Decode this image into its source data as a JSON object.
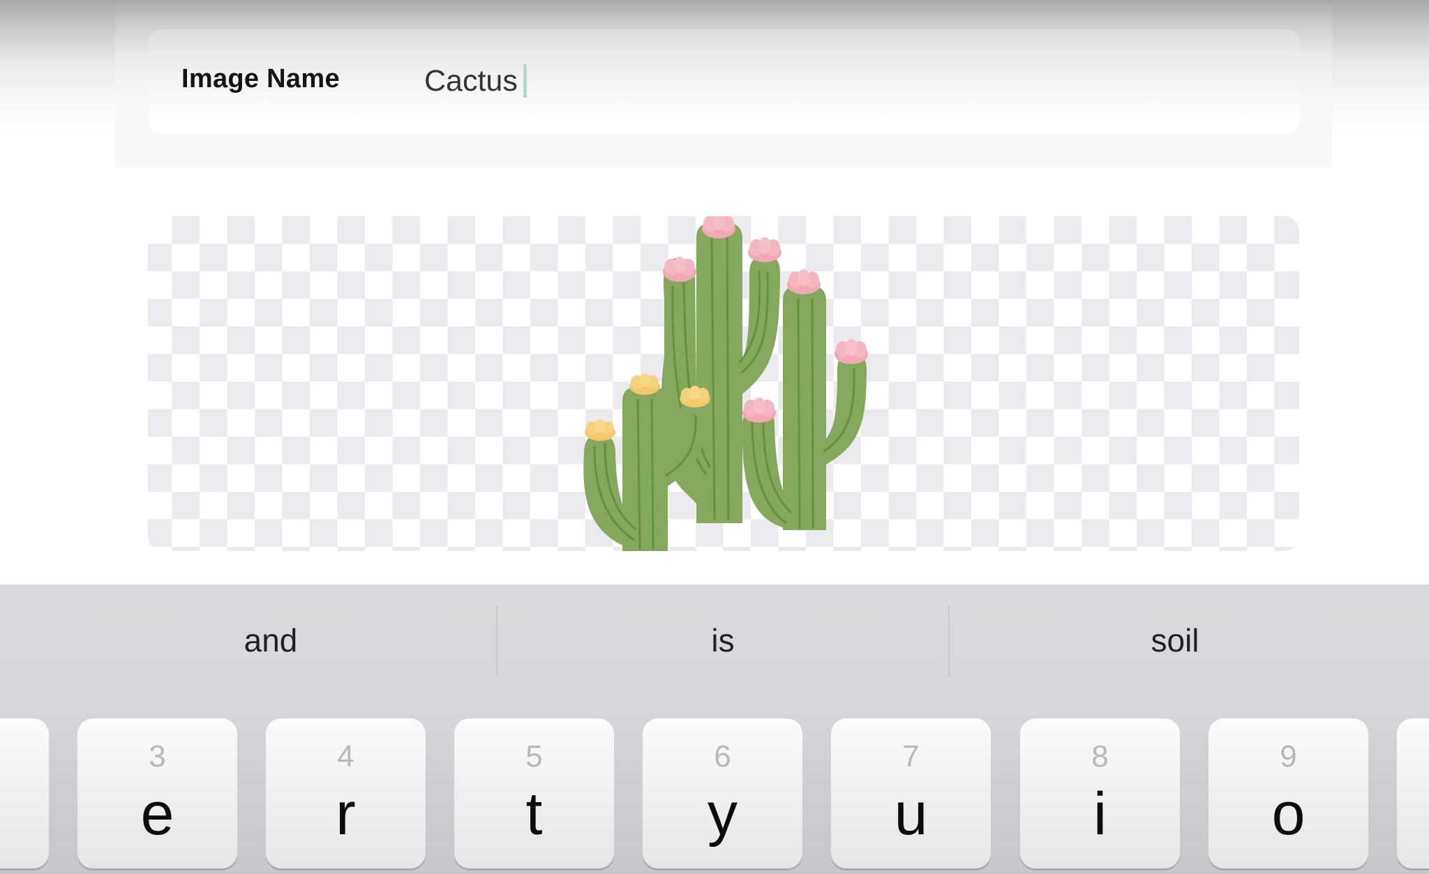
{
  "form": {
    "image_name_label": "Image Name",
    "image_name_value": "Cactus"
  },
  "image_preview": {
    "subject": "three flowering saguaro cacti on transparent background",
    "colors": {
      "cactus_green": "#86a85e",
      "rib_green": "#5f8a3a",
      "flower_pink": "#f1a9b4",
      "flower_yellow": "#f4c869",
      "checker_light": "#ffffff",
      "checker_dark": "#ebebef"
    }
  },
  "keyboard": {
    "suggestions": [
      "and",
      "is",
      "soil"
    ],
    "keys": [
      {
        "num": "",
        "letter": ""
      },
      {
        "num": "3",
        "letter": "e"
      },
      {
        "num": "4",
        "letter": "r"
      },
      {
        "num": "5",
        "letter": "t"
      },
      {
        "num": "6",
        "letter": "y"
      },
      {
        "num": "7",
        "letter": "u"
      },
      {
        "num": "8",
        "letter": "i"
      },
      {
        "num": "9",
        "letter": "o"
      },
      {
        "num": "",
        "letter": ""
      }
    ]
  },
  "accent": {
    "caret_color": "#b9d4cc",
    "keyboard_bg": "#d9dadd"
  }
}
